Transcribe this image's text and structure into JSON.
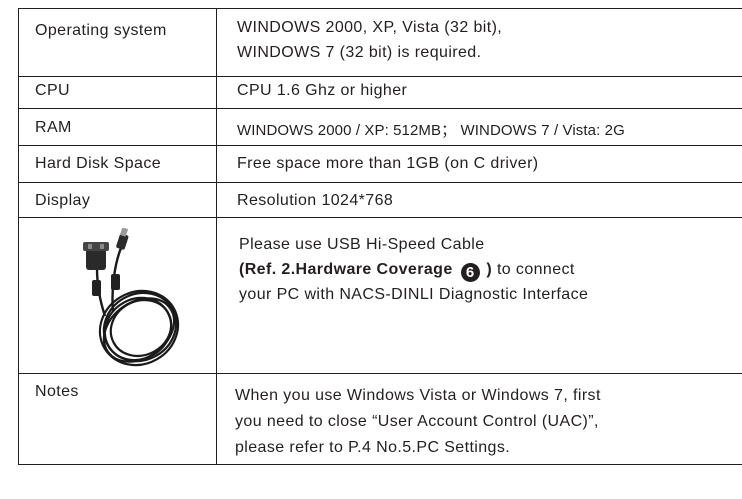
{
  "rows": {
    "os": {
      "label": "Operating system",
      "lines": [
        "WINDOWS 2000, XP, Vista (32 bit),",
        "WINDOWS 7 (32 bit) is required."
      ]
    },
    "cpu": {
      "label": "CPU",
      "value": "CPU 1.6 Ghz or higher"
    },
    "ram": {
      "label": "RAM",
      "value": "WINDOWS 2000 / XP: 512MB； WINDOWS 7 / Vista: 2G"
    },
    "hdd": {
      "label": "Hard Disk Space",
      "value": "Free space more than 1GB (on C driver)"
    },
    "display": {
      "label": "Display",
      "value": "Resolution 1024*768"
    },
    "cable": {
      "image_icon": "usb-cable-icon",
      "line1": "Please use USB Hi-Speed Cable",
      "ref_prefix": "(Ref. 2.Hardware Coverage",
      "ref_number": "6",
      "ref_suffix": ")",
      "line2_rest": " to connect",
      "line3": "your PC with NACS-DINLI Diagnostic Interface"
    },
    "notes": {
      "label": "Notes",
      "lines": [
        "When you use Windows Vista or Windows 7, first",
        "you need to close “User Account Control (UAC)”,",
        "please refer to P.4 No.5.PC Settings."
      ]
    }
  },
  "colors": {
    "text": "#231f20",
    "border": "#231f20",
    "background": "#ffffff"
  }
}
